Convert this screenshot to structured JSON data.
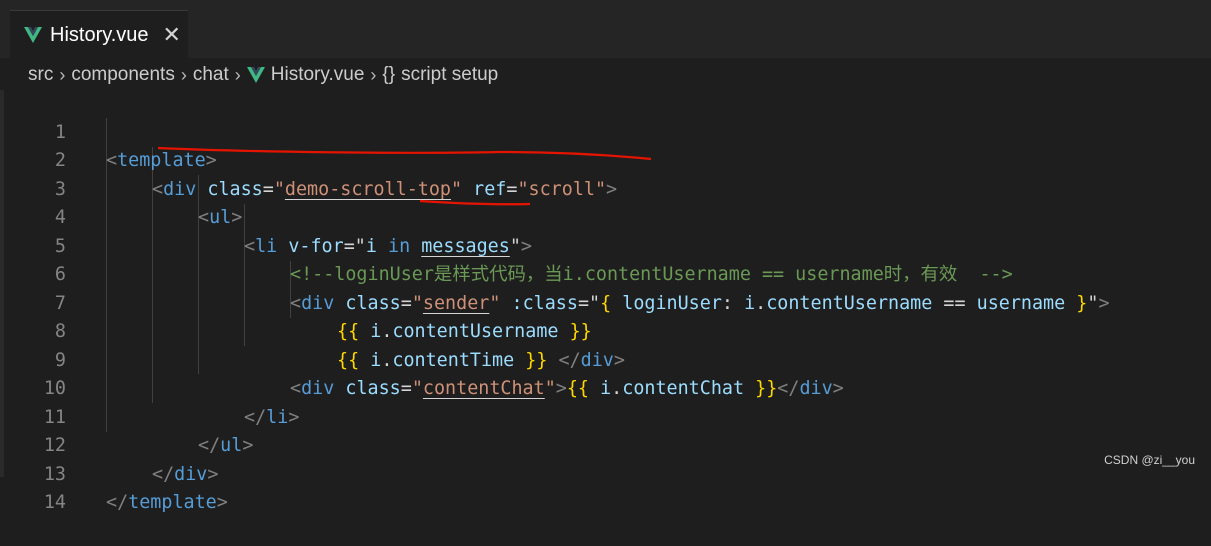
{
  "tab": {
    "title": "History.vue",
    "close": "✕"
  },
  "breadcrumb": [
    "src",
    "components",
    "chat",
    "History.vue",
    "script setup"
  ],
  "breadcrumb_sep": "›",
  "breadcrumb_brace": "{}",
  "line_numbers": [
    "1",
    "2",
    "3",
    "4",
    "5",
    "6",
    "7",
    "8",
    "9",
    "10",
    "11",
    "12",
    "13",
    "14"
  ],
  "code": {
    "l1": {
      "open": "<",
      "tag": "template",
      "close": ">"
    },
    "l2": {
      "open": "<",
      "tag": "div",
      "sp": " ",
      "a1": "class",
      "eq": "=",
      "q": "\"",
      "v1": "demo-scroll-top",
      "a2": "ref",
      "v2": "scroll",
      "close": ">"
    },
    "l3": {
      "open": "<",
      "tag": "ul",
      "close": ">"
    },
    "l4": {
      "open": "<",
      "tag": "li",
      "a1": "v-for",
      "eq": "=",
      "q": "\"",
      "var": "i",
      "kw": "in",
      "v1": "messages",
      "close": ">"
    },
    "l5": {
      "comment": "<!--loginUser是样式代码，当i.contentUsername == username时，有效  -->"
    },
    "l6": {
      "open": "<",
      "tag": "div",
      "a1": "class",
      "v1": "sender",
      "a2": ":class",
      "lb": "{",
      "k": "loginUser",
      "colon": ":",
      "obj": "i",
      "dot": ".",
      "prop": "contentUsername",
      "op": "==",
      "var2": "username",
      "rb": "}",
      "close": ">"
    },
    "l7": {
      "mo": "{{",
      "obj": "i",
      "dot": ".",
      "prop": "contentUsername",
      "mc": "}}"
    },
    "l8": {
      "mo": "{{",
      "obj": "i",
      "dot": ".",
      "prop": "contentTime",
      "mc": "}}",
      "ctag": "div"
    },
    "l9": {
      "tag": "div",
      "a1": "class",
      "v1": "contentChat",
      "mo": "{{",
      "obj": "i",
      "dot": ".",
      "prop": "contentChat",
      "mc": "}}",
      "ctag": "div"
    },
    "l10": {
      "tag": "li"
    },
    "l11": {
      "tag": "ul"
    },
    "l12": {
      "tag": "div"
    },
    "l13": {
      "tag": "template"
    }
  },
  "watermark": "CSDN @zi__you",
  "colors": {
    "tag": "#569cd6",
    "attr": "#9cdcfe",
    "string": "#ce9178",
    "comment": "#6a9955",
    "mustache": "#ffd700",
    "annotation": "#e51400"
  }
}
